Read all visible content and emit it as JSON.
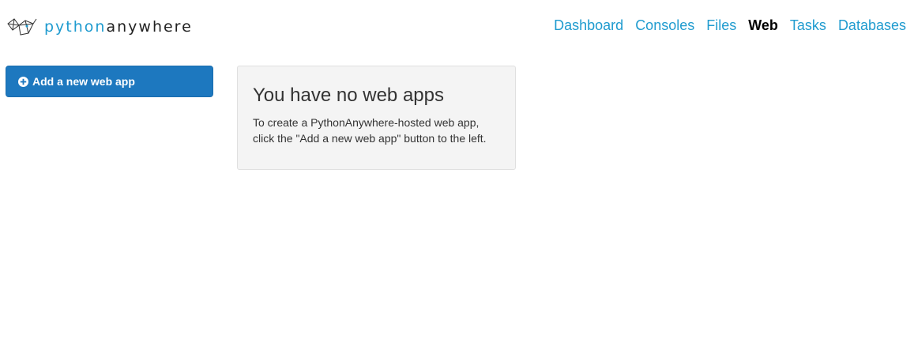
{
  "brand": {
    "python": "python",
    "anywhere": "anywhere",
    "logo_icon": "pythonanywhere-logo-icon"
  },
  "nav": {
    "items": [
      {
        "label": "Dashboard",
        "active": false
      },
      {
        "label": "Consoles",
        "active": false
      },
      {
        "label": "Files",
        "active": false
      },
      {
        "label": "Web",
        "active": true
      },
      {
        "label": "Tasks",
        "active": false
      },
      {
        "label": "Databases",
        "active": false
      }
    ]
  },
  "sidebar": {
    "add_button_label": "Add a new web app",
    "add_button_icon": "plus-circle-icon"
  },
  "main": {
    "title": "You have no web apps",
    "line1": "To create a PythonAnywhere-hosted web app,",
    "line2": "click the \"Add a new web app\" button to the left."
  },
  "colors": {
    "link": "#1f9bcf",
    "button": "#1d78bf",
    "panel_bg": "#f4f4f4"
  }
}
